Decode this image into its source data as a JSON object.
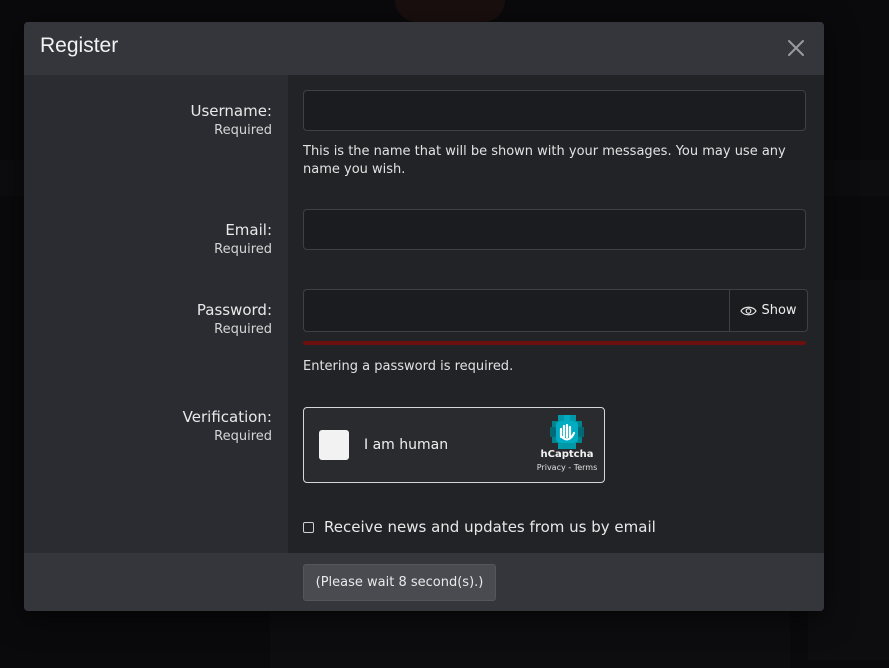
{
  "modal": {
    "title": "Register",
    "fields": {
      "username": {
        "label": "Username:",
        "required": "Required",
        "hint": "This is the name that will be shown with your messages. You may use any name you wish."
      },
      "email": {
        "label": "Email:",
        "required": "Required"
      },
      "password": {
        "label": "Password:",
        "required": "Required",
        "show_label": "Show",
        "error": "Entering a password is required."
      },
      "verification": {
        "label": "Verification:",
        "required": "Required",
        "captcha_text": "I am human",
        "captcha_brand": "hCaptcha",
        "captcha_links": "Privacy - Terms"
      }
    },
    "newsletter_label": "Receive news and updates from us by email",
    "submit_label": "(Please wait 8 second(s).)"
  },
  "colors": {
    "field_bg": "#222327",
    "header_bg": "#35363b",
    "error_bar": "#6b0f0f",
    "captcha_teal": "#00838f"
  }
}
